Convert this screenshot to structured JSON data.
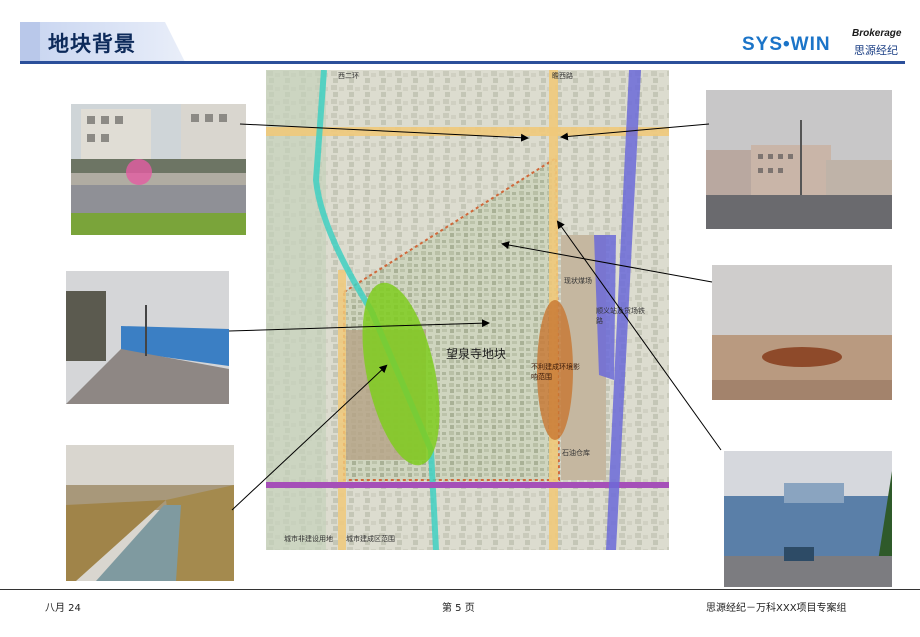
{
  "header": {
    "title": "地块背景",
    "logo_main": "SYS•WIN",
    "logo_sub": "Brokerage",
    "logo_cn": "思源经纪"
  },
  "map": {
    "road_west": "西二环",
    "road_north": "瞻西路",
    "site_label": "望泉寺地块",
    "label_status": "现状煤场",
    "label_station": "顺义站及货场铁路",
    "label_impact": "不利建成环境影响范围",
    "label_depot": "石油仓库",
    "legend_non_built": "城市非建设用地",
    "legend_built": "城市建成区范围"
  },
  "footer": {
    "date": "八月 24",
    "page": "第 5 页",
    "company": "思源经纪－万科XXX项目专案组"
  },
  "colors": {
    "brand_blue": "#2b4f9a",
    "logo_blue": "#1b74c8"
  }
}
